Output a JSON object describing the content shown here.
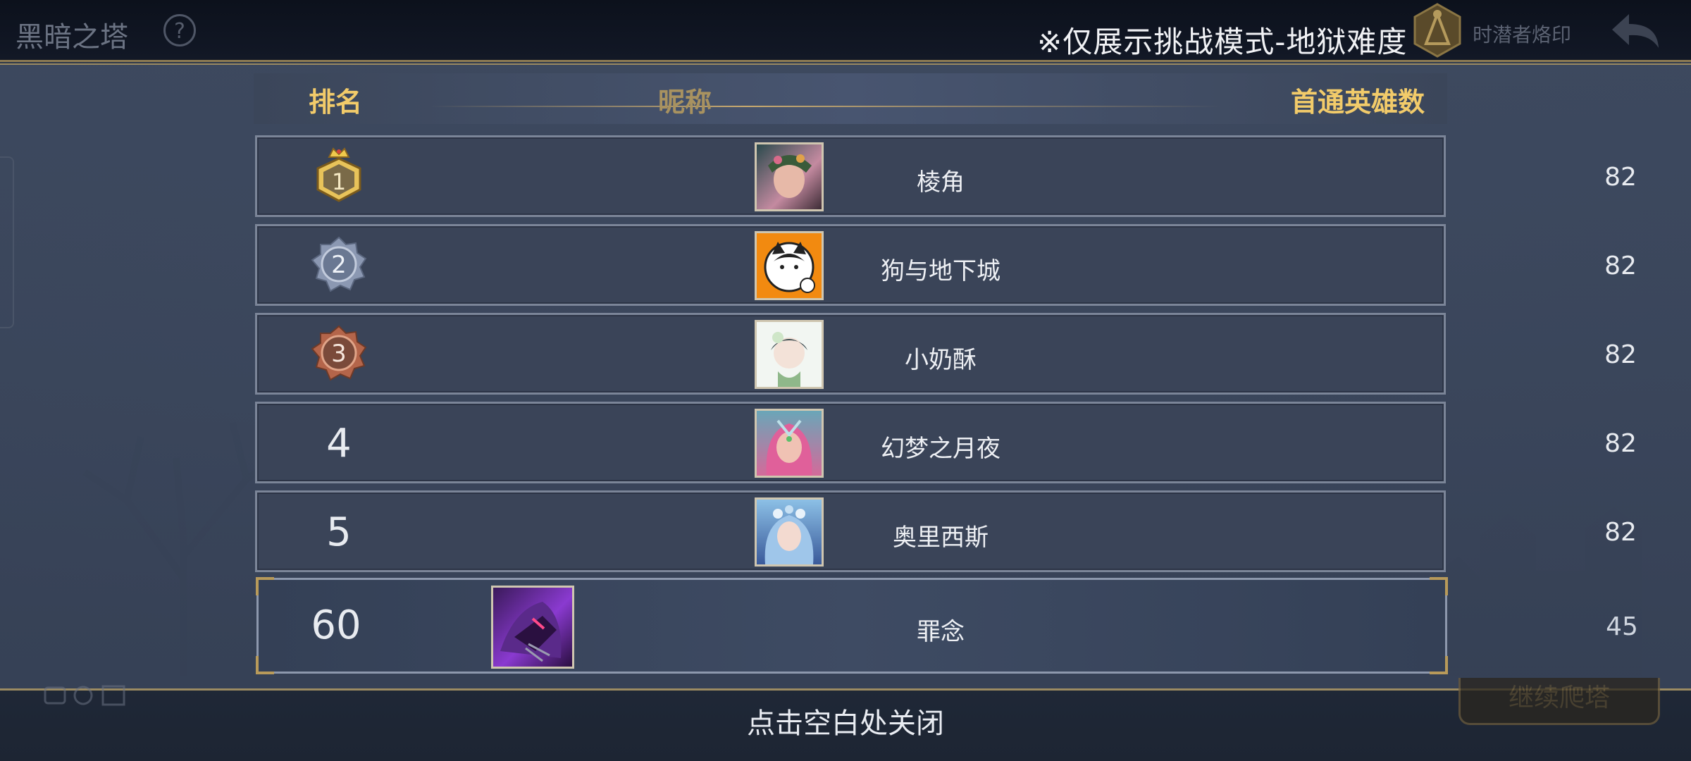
{
  "header": {
    "game_title": "黑暗之塔",
    "help_icon": "question-gear-icon",
    "notice": "※仅展示挑战模式-地狱难度",
    "emblem_label": "时潜者烙印",
    "back_icon": "back-arrow-icon"
  },
  "table": {
    "columns": {
      "rank": "排名",
      "name": "昵称",
      "count": "首通英雄数"
    },
    "rows": [
      {
        "rank": "1",
        "medal": "gold-crown-medal",
        "name": "棱角",
        "count": "82"
      },
      {
        "rank": "2",
        "medal": "silver-medal",
        "name": "狗与地下城",
        "count": "82"
      },
      {
        "rank": "3",
        "medal": "bronze-medal",
        "name": "小奶酥",
        "count": "82"
      },
      {
        "rank": "4",
        "name": "幻梦之月夜",
        "count": "82"
      },
      {
        "rank": "5",
        "name": "奥里西斯",
        "count": "82"
      }
    ],
    "self": {
      "rank": "60",
      "name": "罪念",
      "count": "45"
    }
  },
  "footer": {
    "close_hint": "点击空白处关闭",
    "continue_button": "继续爬塔"
  },
  "colors": {
    "accent_gold": "#f2cb6a",
    "panel": "#3a4458",
    "border_gold": "#9c8b62"
  }
}
